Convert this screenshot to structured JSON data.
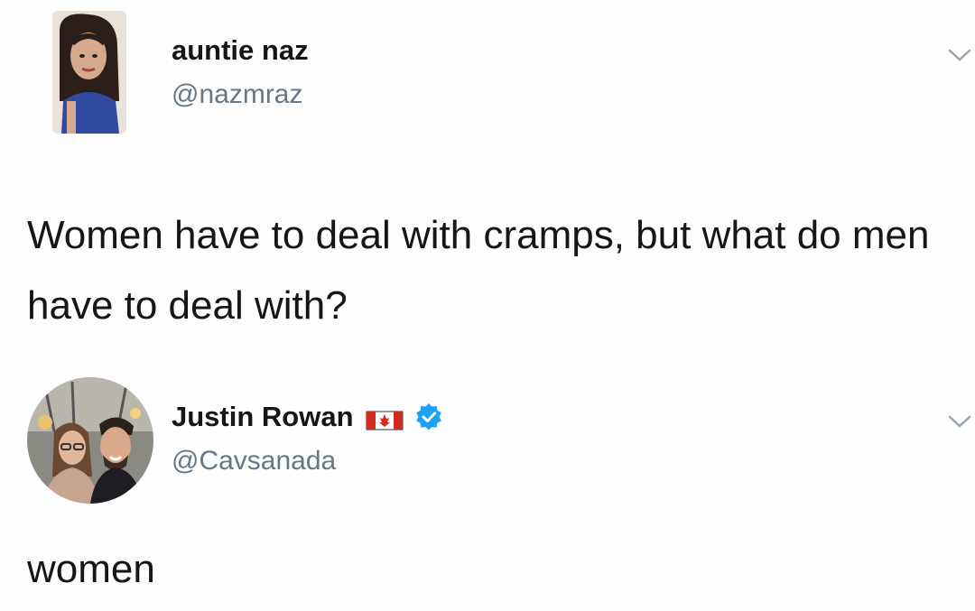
{
  "tweets": [
    {
      "display_name": "auntie naz",
      "handle": "@nazmraz",
      "text": "Women have to deal with cramps, but what do men have to deal with?"
    },
    {
      "display_name": "Justin Rowan",
      "handle": "@Cavsanada",
      "verified": true,
      "flag": "canada-flag-icon",
      "text": "women"
    }
  ],
  "colors": {
    "text": "#14171a",
    "handle": "#657786",
    "verified": "#1da1f2",
    "flag_red": "#d52b1e"
  }
}
